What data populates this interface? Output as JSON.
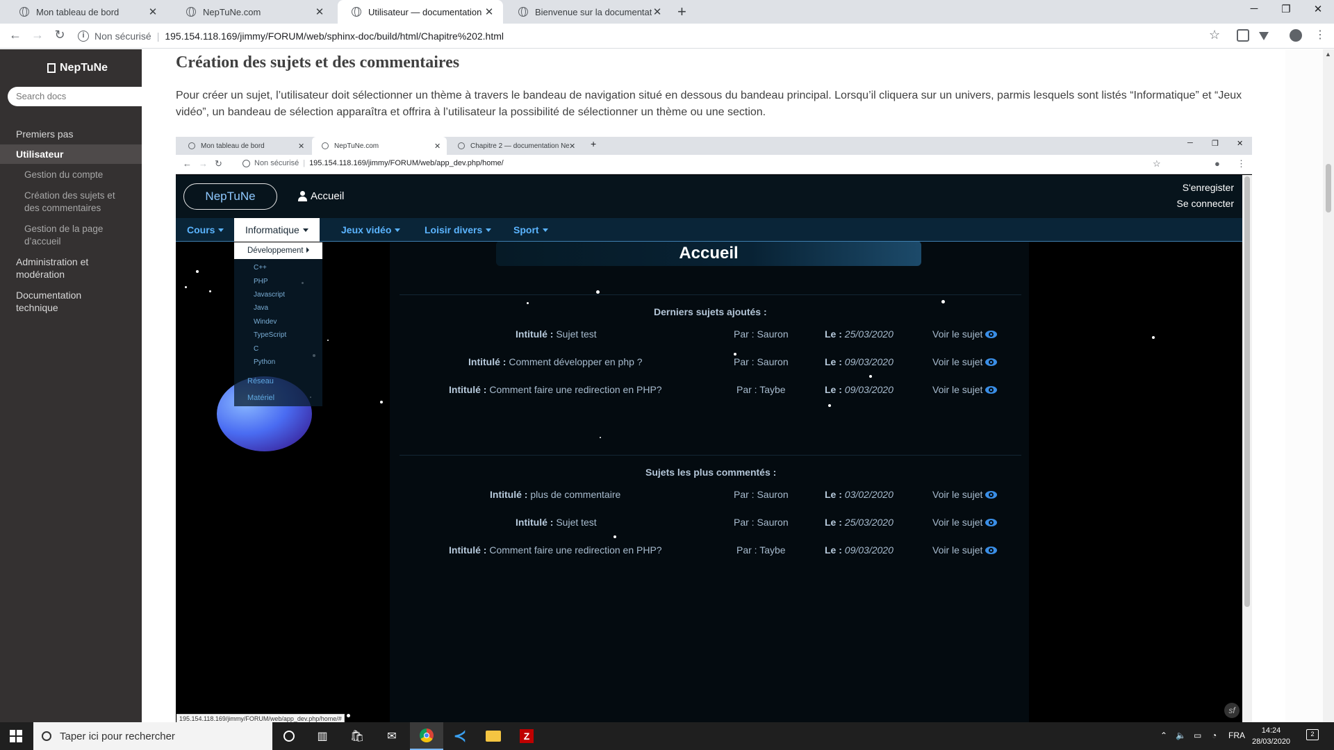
{
  "browser": {
    "tabs": [
      {
        "label": "Mon tableau de bord"
      },
      {
        "label": "NepTuNe.com"
      },
      {
        "label": "Utilisateur — documentation Ne"
      },
      {
        "label": "Bienvenue sur la documentation"
      }
    ],
    "new_tab": "+",
    "window": {
      "minimize": "─",
      "restore": "❐",
      "close": "✕"
    },
    "nav": {
      "back": "←",
      "forward": "→",
      "reload": "↻"
    },
    "omnibox": {
      "security": "Non sécurisé",
      "url": "195.154.118.169/jimmy/FORUM/web/sphinx-doc/build/html/Chapitre%202.html"
    }
  },
  "sidebar": {
    "logo": "NepTuNe",
    "search_placeholder": "Search docs",
    "items": [
      {
        "label": "Premiers pas"
      },
      {
        "label": "Utilisateur"
      },
      {
        "label": "Gestion du compte"
      },
      {
        "label": "Création des sujets et des commentaires"
      },
      {
        "label": "Gestion de la page d’accueil"
      },
      {
        "label": "Administration et modération"
      },
      {
        "label": "Documentation technique"
      }
    ]
  },
  "doc": {
    "heading": "Création des sujets et des commentaires",
    "paragraph": "Pour créer un sujet, l’utilisateur doit sélectionner un thème à travers le bandeau de navigation situé en dessous du bandeau principal. Lorsqu’il cliquera sur un univers, parmis lesquels sont listés “Informatique” et “Jeux vidéo”, un bandeau de sélection apparaîtra et offrira à l’utilisateur la possibilité de sélectionner un thème ou une section."
  },
  "inner": {
    "tabs": [
      {
        "label": "Mon tableau de bord"
      },
      {
        "label": "NepTuNe.com"
      },
      {
        "label": "Chapitre 2 — documentation Ne"
      }
    ],
    "omnibox": {
      "security": "Non sécurisé",
      "url": "195.154.118.169/jimmy/FORUM/web/app_dev.php/home/"
    },
    "site": {
      "brand": "NepTuNe",
      "home": "Accueil",
      "register": "S'enregister",
      "login": "Se connecter",
      "nav": [
        {
          "label": "Cours"
        },
        {
          "label": "Informatique"
        },
        {
          "label": "Jeux vidéo"
        },
        {
          "label": "Loisir divers"
        },
        {
          "label": "Sport"
        }
      ],
      "dropdown": {
        "header": "Développement",
        "subitems": [
          "C++",
          "PHP",
          "Javascript",
          "Java",
          "Windev",
          "TypeScript",
          "C",
          "Python"
        ],
        "sections": [
          "Réseau",
          "Matériel"
        ]
      },
      "banner": "Accueil",
      "latest": {
        "title": "Derniers sujets ajoutés :",
        "rows": [
          {
            "label": "Intitulé :",
            "subject": "Sujet test",
            "author": "Par : Sauron",
            "date_label": "Le :",
            "date": "25/03/2020",
            "link": "Voir le sujet"
          },
          {
            "label": "Intitulé :",
            "subject": "Comment développer en php ?",
            "author": "Par : Sauron",
            "date_label": "Le :",
            "date": "09/03/2020",
            "link": "Voir le sujet"
          },
          {
            "label": "Intitulé :",
            "subject": "Comment faire une redirection en PHP?",
            "author": "Par : Taybe",
            "date_label": "Le :",
            "date": "09/03/2020",
            "link": "Voir le sujet"
          }
        ]
      },
      "most_commented": {
        "title": "Sujets les plus commentés :",
        "rows": [
          {
            "label": "Intitulé :",
            "subject": "plus de commentaire",
            "author": "Par : Sauron",
            "date_label": "Le :",
            "date": "03/02/2020",
            "link": "Voir le sujet"
          },
          {
            "label": "Intitulé :",
            "subject": "Sujet test",
            "author": "Par : Sauron",
            "date_label": "Le :",
            "date": "25/03/2020",
            "link": "Voir le sujet"
          },
          {
            "label": "Intitulé :",
            "subject": "Comment faire une redirection en PHP?",
            "author": "Par : Taybe",
            "date_label": "Le :",
            "date": "09/03/2020",
            "link": "Voir le sujet"
          }
        ]
      },
      "status_url": "195.154.118.169/jimmy/FORUM/web/app_dev.php/home/#"
    }
  },
  "taskbar": {
    "search_placeholder": "Taper ici pour rechercher",
    "language": "FRA",
    "time": "14:24",
    "date": "28/03/2020",
    "notifications": "2"
  }
}
